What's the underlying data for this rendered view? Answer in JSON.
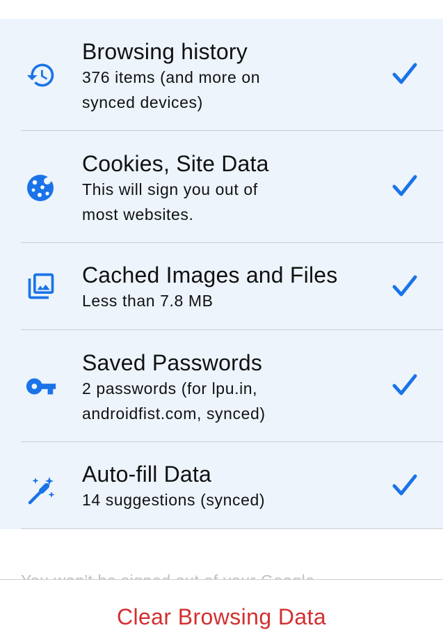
{
  "colors": {
    "accent": "#1a73e8",
    "destructive": "#d32f2f",
    "list_background": "#edf4fc",
    "divider": "#c9ced6"
  },
  "items": [
    {
      "icon": "history-icon",
      "title": "Browsing history",
      "subtitle_lines": [
        "376 items (and more on",
        "synced devices)"
      ],
      "checked": true
    },
    {
      "icon": "cookie-icon",
      "title": "Cookies, Site Data",
      "subtitle_lines": [
        "This will sign you out of",
        "most websites."
      ],
      "checked": true
    },
    {
      "icon": "image-stack-icon",
      "title": "Cached Images and Files",
      "subtitle_lines": [
        "Less than 7.8 MB"
      ],
      "checked": true
    },
    {
      "icon": "key-icon",
      "title": "Saved Passwords",
      "subtitle_lines": [
        "2 passwords (for lpu.in,",
        "androidfist.com, synced)"
      ],
      "checked": true
    },
    {
      "icon": "magic-wand-icon",
      "title": "Auto-fill Data",
      "subtitle_lines": [
        "14 suggestions (synced)"
      ],
      "checked": true
    }
  ],
  "footnote": "You won't be signed out of your Google",
  "clear_button_label": "Clear Browsing Data"
}
